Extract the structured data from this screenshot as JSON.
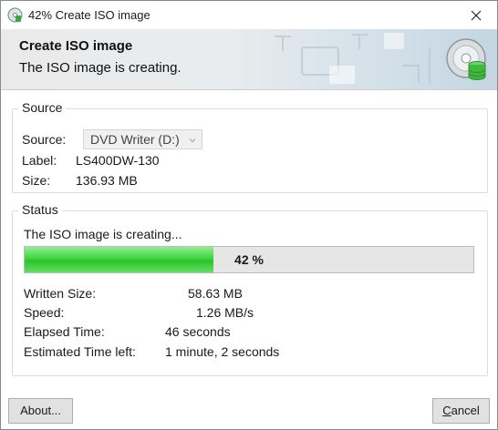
{
  "window": {
    "title": "42% Create ISO image",
    "close_icon": "close-icon"
  },
  "banner": {
    "heading": "Create ISO image",
    "subtitle": "The ISO image is creating.",
    "icon": "disc-database-icon"
  },
  "source": {
    "group_title": "Source",
    "source_label": "Source:",
    "source_value": "DVD Writer (D:)",
    "label_label": "Label:",
    "label_value": "LS400DW-130",
    "size_label": "Size:",
    "size_value": "136.93 MB"
  },
  "status": {
    "group_title": "Status",
    "message": "The ISO image is creating...",
    "progress_percent": 42,
    "progress_text": "42 %",
    "progress_color": "#3fd43f",
    "written_label": "Written Size:",
    "written_value": "58.63 MB",
    "speed_label": "Speed:",
    "speed_value": "1.26 MB/s",
    "elapsed_label": "Elapsed Time:",
    "elapsed_value": "46 seconds",
    "remaining_label": "Estimated Time left:",
    "remaining_value": "1 minute, 2 seconds"
  },
  "buttons": {
    "about": "About...",
    "cancel": "Cancel"
  }
}
